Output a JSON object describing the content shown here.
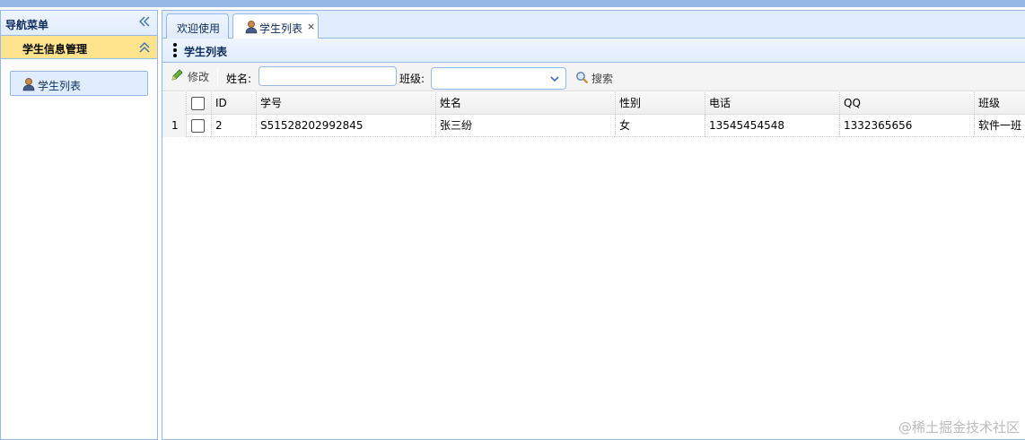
{
  "nav": {
    "title": "导航菜单",
    "section": "学生信息管理",
    "items": [
      {
        "label": "学生列表",
        "icon": "user-icon"
      }
    ]
  },
  "tabs": [
    {
      "label": "欢迎使用"
    },
    {
      "label": "学生列表",
      "icon": "user-icon",
      "close": "×"
    }
  ],
  "panel": {
    "title": "学生列表"
  },
  "toolbar": {
    "edit_label": "修改",
    "name_label": "姓名:",
    "name_value": "",
    "class_label": "班级:",
    "class_value": "",
    "search_label": "搜索"
  },
  "grid": {
    "columns": [
      "ID",
      "学号",
      "姓名",
      "性别",
      "电话",
      "QQ",
      "班级"
    ],
    "rows": [
      {
        "rownum": "1",
        "id": "2",
        "sn": "S51528202992845",
        "name": "张三纷",
        "sex": "女",
        "phone": "13545454548",
        "qq": "1332365656",
        "class": "软件一班"
      }
    ]
  },
  "watermark": "@稀土掘金技术社区",
  "colors": {
    "border": "#95b8e7",
    "header_bg": "#e0ecff",
    "accordion_selected": "#ffe48d"
  }
}
